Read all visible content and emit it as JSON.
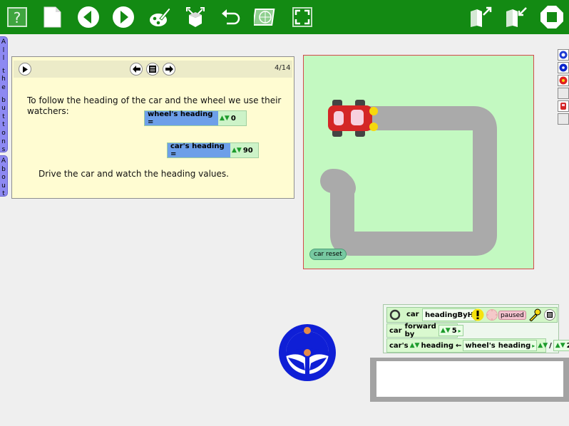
{
  "flaps": {
    "all_buttons": [
      "A",
      "l",
      "l",
      "t",
      "h",
      "e",
      "b",
      "u",
      "t",
      "t",
      "o",
      "n",
      "s"
    ],
    "about": [
      "A",
      "b",
      "o",
      "u",
      "t"
    ]
  },
  "book": {
    "page_indicator": "4/14",
    "line1": "To follow the heading of the car and the wheel we use their",
    "line2": "watchers:",
    "instruction": "Drive the car and watch the heading values."
  },
  "watchers": {
    "wheel": {
      "label": "wheel's heading =",
      "value": "0"
    },
    "car": {
      "label": "car's heading =",
      "value": "90"
    }
  },
  "stage": {
    "reset_label": "car reset",
    "colors": {
      "background": "#c3f9c1",
      "track": "#aaaaaa",
      "car_body": "#d42626"
    }
  },
  "script": {
    "object": "car",
    "name": "headingByH",
    "status": "paused",
    "row1": {
      "verb": "car",
      "action": "forward by",
      "amount": "5"
    },
    "row2": {
      "subject": "car's",
      "property": "heading",
      "arrow": "←",
      "source": "wheel's",
      "source_property": "heading",
      "op": "/",
      "divisor": "2"
    }
  },
  "icons": [
    "help-icon",
    "new-page-icon",
    "previous-page-icon",
    "next-page-icon",
    "paint-icon",
    "supplies-icon",
    "undo-icon",
    "publish-icon",
    "fullscreen-icon",
    "load-icon",
    "save-icon",
    "stop-icon"
  ]
}
